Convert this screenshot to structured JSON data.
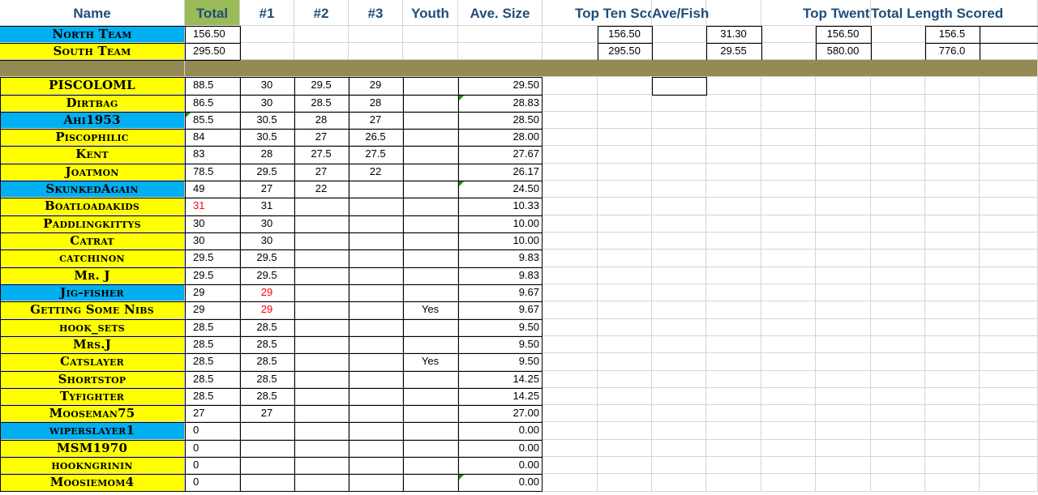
{
  "headers": {
    "name": "Name",
    "total": "Total",
    "c1": "#1",
    "c2": "#2",
    "c3": "#3",
    "youth": "Youth",
    "ave_size": "Ave. Size",
    "top_ten": "Top Ten Score",
    "ave_fish": "Ave/Fish",
    "top_twenty": "Top Twenty",
    "total_length": "Total Length Scored"
  },
  "teams": [
    {
      "name": "North Team",
      "color": "#00b0f0",
      "total": "156.50",
      "top_ten": "156.50",
      "ave_fish": "31.30",
      "top_twenty": "156.50",
      "total_length": "156.5"
    },
    {
      "name": "South Team",
      "color": "#ffff00",
      "total": "295.50",
      "top_ten": "295.50",
      "ave_fish": "29.55",
      "top_twenty": "580.00",
      "total_length": "776.0"
    }
  ],
  "players": [
    {
      "name": "PISCOLOML",
      "team": "yellow",
      "total": "88.5",
      "c1": "30",
      "c2": "29.5",
      "c3": "29",
      "youth": "",
      "ave": "29.50"
    },
    {
      "name": "Dirtbag",
      "team": "yellow",
      "total": "86.5",
      "c1": "30",
      "c2": "28.5",
      "c3": "28",
      "youth": "",
      "ave": "28.83"
    },
    {
      "name": "Ahi1953",
      "team": "blue",
      "total": "85.5",
      "c1": "30.5",
      "c2": "28",
      "c3": "27",
      "youth": "",
      "ave": "28.50"
    },
    {
      "name": "Piscophilic",
      "team": "yellow",
      "total": "84",
      "c1": "30.5",
      "c2": "27",
      "c3": "26.5",
      "youth": "",
      "ave": "28.00"
    },
    {
      "name": "Kent",
      "team": "yellow",
      "total": "83",
      "c1": "28",
      "c2": "27.5",
      "c3": "27.5",
      "youth": "",
      "ave": "27.67"
    },
    {
      "name": "Joatmon",
      "team": "yellow",
      "total": "78.5",
      "c1": "29.5",
      "c2": "27",
      "c3": "22",
      "youth": "",
      "ave": "26.17"
    },
    {
      "name": "SkunkedAgain",
      "team": "blue",
      "total": "49",
      "c1": "27",
      "c2": "22",
      "c3": "",
      "youth": "",
      "ave": "24.50"
    },
    {
      "name": "Boatloadakids",
      "team": "yellow",
      "total": "31",
      "c1": "31",
      "c2": "",
      "c3": "",
      "youth": "",
      "ave": "10.33",
      "total_red": true
    },
    {
      "name": "Paddlingkittys",
      "team": "yellow",
      "total": "30",
      "c1": "30",
      "c2": "",
      "c3": "",
      "youth": "",
      "ave": "10.00"
    },
    {
      "name": "Catrat",
      "team": "yellow",
      "total": "30",
      "c1": "30",
      "c2": "",
      "c3": "",
      "youth": "",
      "ave": "10.00"
    },
    {
      "name": "catchinon",
      "team": "yellow",
      "total": "29.5",
      "c1": "29.5",
      "c2": "",
      "c3": "",
      "youth": "",
      "ave": "9.83"
    },
    {
      "name": "Mr. J",
      "team": "yellow",
      "total": "29.5",
      "c1": "29.5",
      "c2": "",
      "c3": "",
      "youth": "",
      "ave": "9.83"
    },
    {
      "name": "Jig-fisher",
      "team": "blue",
      "total": "29",
      "c1": "29",
      "c2": "",
      "c3": "",
      "youth": "",
      "ave": "9.67",
      "c1_red": true
    },
    {
      "name": "Getting Some Nibs",
      "team": "yellow",
      "total": "29",
      "c1": "29",
      "c2": "",
      "c3": "",
      "youth": "Yes",
      "ave": "9.67",
      "c1_red": true
    },
    {
      "name": "hook_sets",
      "team": "yellow",
      "total": "28.5",
      "c1": "28.5",
      "c2": "",
      "c3": "",
      "youth": "",
      "ave": "9.50"
    },
    {
      "name": "Mrs.J",
      "team": "yellow",
      "total": "28.5",
      "c1": "28.5",
      "c2": "",
      "c3": "",
      "youth": "",
      "ave": "9.50"
    },
    {
      "name": "Catslayer",
      "team": "yellow",
      "total": "28.5",
      "c1": "28.5",
      "c2": "",
      "c3": "",
      "youth": "Yes",
      "ave": "9.50"
    },
    {
      "name": "Shortstop",
      "team": "yellow",
      "total": "28.5",
      "c1": "28.5",
      "c2": "",
      "c3": "",
      "youth": "",
      "ave": "14.25"
    },
    {
      "name": "Tyfighter",
      "team": "yellow",
      "total": "28.5",
      "c1": "28.5",
      "c2": "",
      "c3": "",
      "youth": "",
      "ave": "14.25"
    },
    {
      "name": "Mooseman75",
      "team": "yellow",
      "total": "27",
      "c1": "27",
      "c2": "",
      "c3": "",
      "youth": "",
      "ave": "27.00"
    },
    {
      "name": "wiperslayer1",
      "team": "blue",
      "total": "0",
      "c1": "",
      "c2": "",
      "c3": "",
      "youth": "",
      "ave": "0.00"
    },
    {
      "name": "MSM1970",
      "team": "yellow",
      "total": "0",
      "c1": "",
      "c2": "",
      "c3": "",
      "youth": "",
      "ave": "0.00"
    },
    {
      "name": "hookngrinin",
      "team": "yellow",
      "total": "0",
      "c1": "",
      "c2": "",
      "c3": "",
      "youth": "",
      "ave": "0.00"
    },
    {
      "name": "Moosiemom4",
      "team": "yellow",
      "total": "0",
      "c1": "",
      "c2": "",
      "c3": "",
      "youth": "",
      "ave": "0.00"
    }
  ],
  "colors": {
    "header_text": "#1f4e79",
    "yellow": "#ffff00",
    "blue": "#00b0f0",
    "olive": "#948a54",
    "total_header": "#9bbb59"
  }
}
